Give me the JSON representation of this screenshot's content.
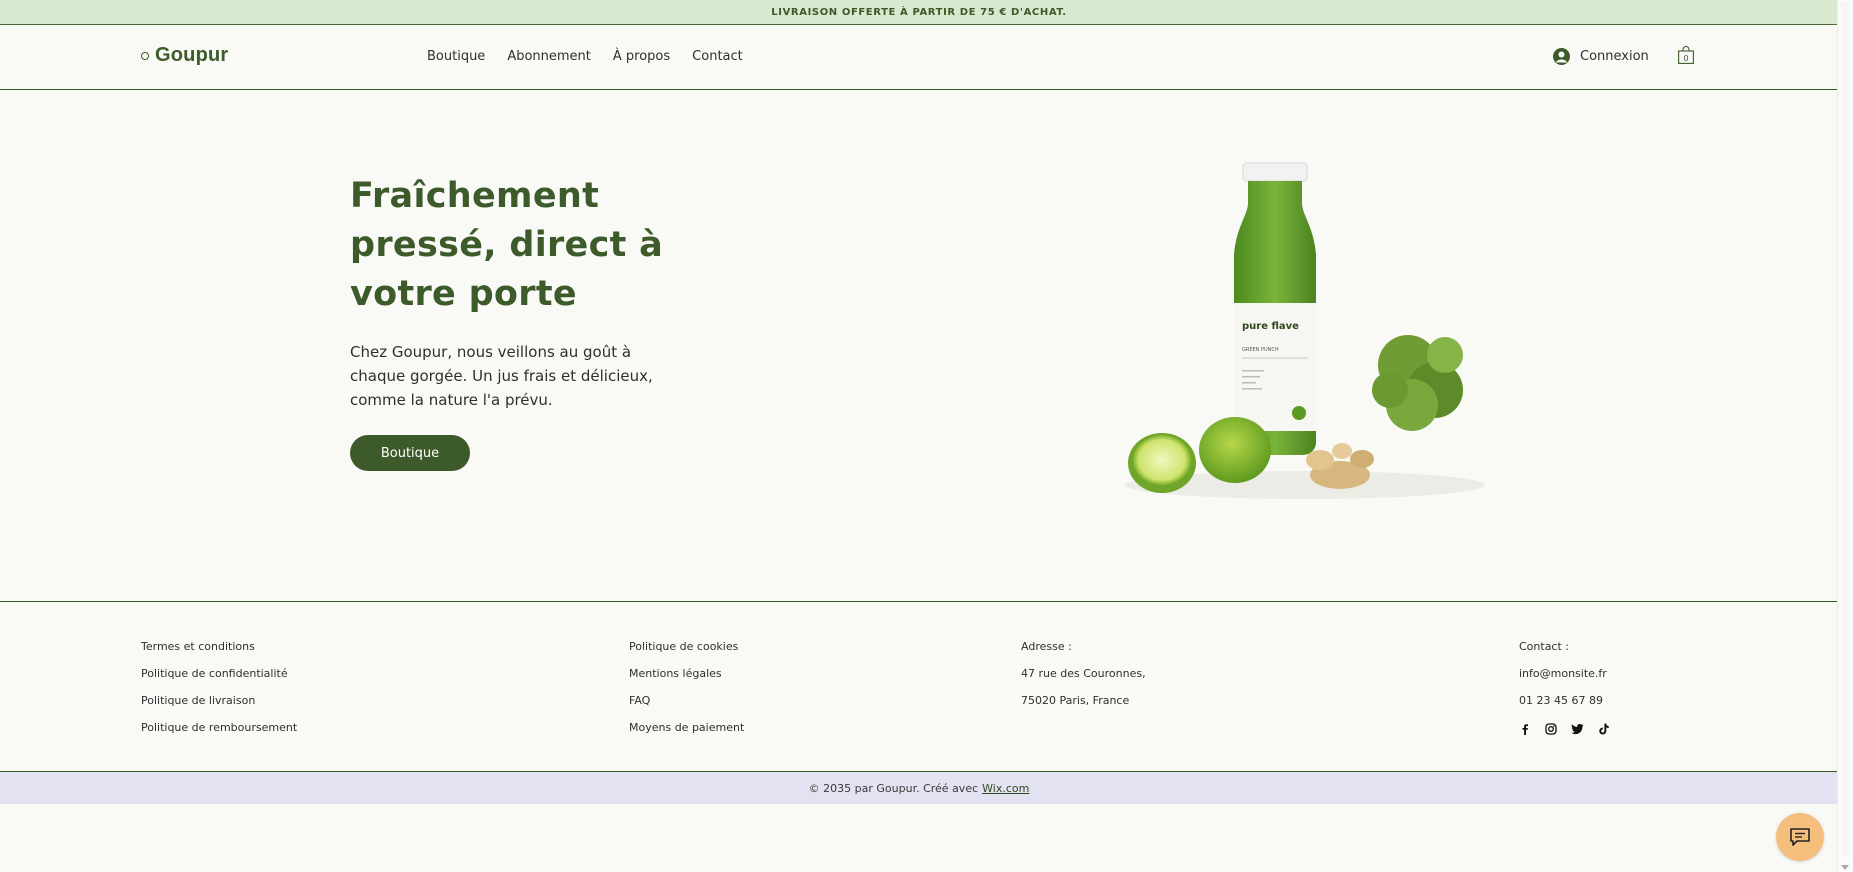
{
  "announcement": {
    "text": "LIVRAISON OFFERTE À PARTIR DE 75 € D'ACHAT."
  },
  "header": {
    "logo": "Goupur",
    "nav": [
      "Boutique",
      "Abonnement",
      "À propos",
      "Contact"
    ],
    "login_label": "Connexion",
    "cart_count": "0"
  },
  "hero": {
    "title": "Fraîchement pressé, direct à votre porte",
    "description": "Chez Goupur, nous veillons au goût à chaque gorgée. Un jus frais et délicieux, comme la nature l'a prévu.",
    "button_label": "Boutique",
    "bottle_brand": "pure flave",
    "bottle_flavor": "GREEN PUNCH"
  },
  "footer": {
    "col1": [
      "Termes et conditions",
      "Politique de confidentialité",
      "Politique de livraison",
      "Politique de remboursement"
    ],
    "col2": [
      "Politique de cookies",
      "Mentions légales",
      "FAQ",
      "Moyens de paiement"
    ],
    "address": {
      "label": "Adresse :",
      "line1": "47 rue des Couronnes,",
      "line2": "75020 Paris, France"
    },
    "contact": {
      "label": "Contact :",
      "email": "info@monsite.fr",
      "phone": "01 23 45 67 89"
    },
    "socials": [
      "facebook-icon",
      "instagram-icon",
      "twitter-icon",
      "tiktok-icon"
    ]
  },
  "copyright": {
    "text": "© 2035 par Goupur. Créé avec",
    "link": "Wix.com"
  },
  "colors": {
    "brand_green": "#3d5a2a",
    "announce_bg": "#d8e9cf",
    "copyright_bg": "#e3e2f2",
    "chat_bg": "#f4bf7d"
  }
}
